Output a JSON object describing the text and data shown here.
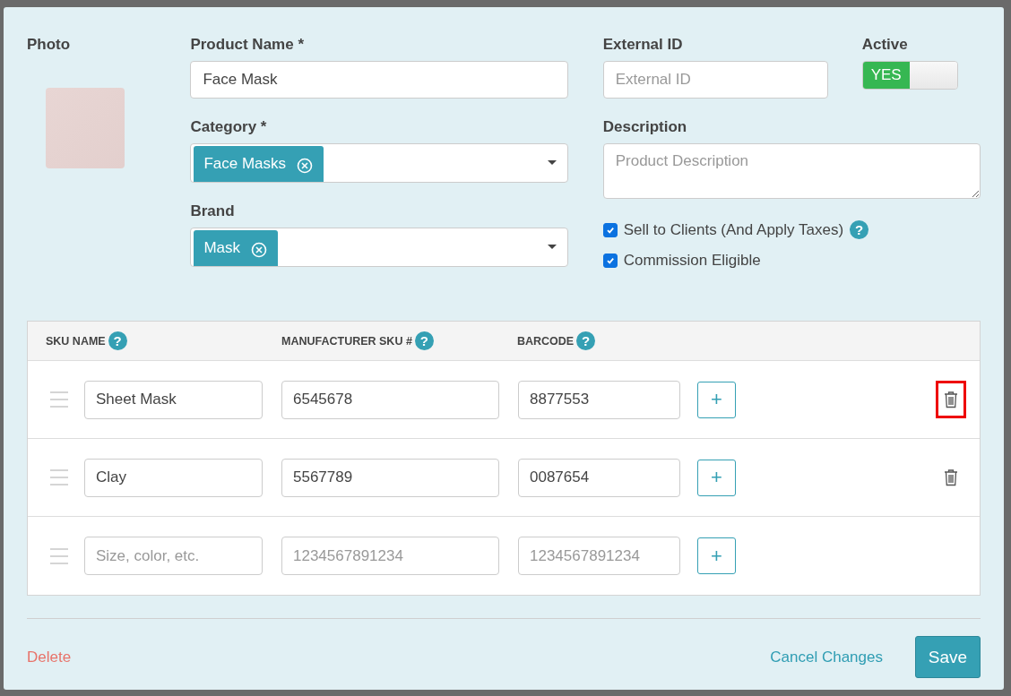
{
  "form": {
    "photo": {
      "label": "Photo"
    },
    "product_name": {
      "label": "Product Name *",
      "value": "Face Mask"
    },
    "category": {
      "label": "Category *",
      "tags": [
        "Face Masks"
      ]
    },
    "brand": {
      "label": "Brand",
      "tags": [
        "Mask"
      ]
    },
    "external_id": {
      "label": "External ID",
      "placeholder": "External ID"
    },
    "active": {
      "label": "Active",
      "on": true,
      "text": "YES"
    },
    "description": {
      "label": "Description",
      "placeholder": "Product Description"
    },
    "checkboxes": [
      {
        "label": "Sell to Clients (And Apply Taxes)",
        "checked": true,
        "help": "?"
      },
      {
        "label": "Commission Eligible",
        "checked": true
      }
    ]
  },
  "sku_table": {
    "columns": [
      {
        "label": "SKU NAME",
        "help": "?"
      },
      {
        "label": "MANUFACTURER SKU #",
        "help": "?"
      },
      {
        "label": "BARCODE",
        "help": "?"
      }
    ],
    "rows": [
      {
        "cells": [
          {
            "value": "Sheet Mask"
          },
          {
            "value": "6545678"
          },
          {
            "value": "8877553"
          }
        ],
        "add": "+",
        "deletable": true,
        "highlighted": true
      },
      {
        "cells": [
          {
            "value": "Clay"
          },
          {
            "value": "5567789"
          },
          {
            "value": "0087654"
          }
        ],
        "add": "+",
        "deletable": true,
        "highlighted": false
      },
      {
        "cells": [
          {
            "placeholder": "Size, color, etc."
          },
          {
            "placeholder": "1234567891234"
          },
          {
            "placeholder": "1234567891234"
          }
        ],
        "add": "+",
        "deletable": false,
        "highlighted": false
      }
    ]
  },
  "footer": {
    "delete": "Delete",
    "cancel": "Cancel Changes",
    "save": "Save"
  }
}
